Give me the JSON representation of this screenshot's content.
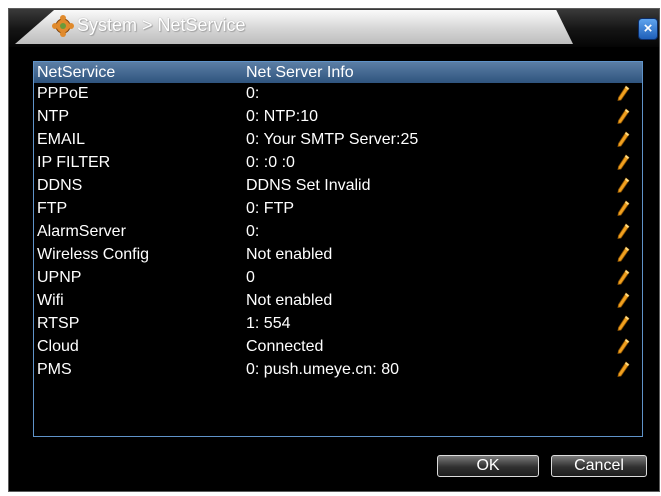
{
  "window": {
    "title": "System > NetService",
    "title_icon": "gear-icon",
    "close_label": "×"
  },
  "table": {
    "headers": [
      "NetService",
      "Net Server Info"
    ],
    "rows": [
      {
        "service": "PPPoE",
        "info": "0:"
      },
      {
        "service": "NTP",
        "info": "0: NTP:10"
      },
      {
        "service": "EMAIL",
        "info": "0: Your SMTP Server:25"
      },
      {
        "service": "IP FILTER",
        "info": "0: :0 :0"
      },
      {
        "service": "DDNS",
        "info": "DDNS Set Invalid"
      },
      {
        "service": "FTP",
        "info": "0: FTP"
      },
      {
        "service": "AlarmServer",
        "info": "0:"
      },
      {
        "service": "Wireless Config",
        "info": "Not enabled"
      },
      {
        "service": "UPNP",
        "info": "0"
      },
      {
        "service": "Wifi",
        "info": "Not enabled"
      },
      {
        "service": "RTSP",
        "info": "1: 554"
      },
      {
        "service": "Cloud",
        "info": "Connected"
      },
      {
        "service": "PMS",
        "info": "0: push.umeye.cn: 80"
      }
    ],
    "row_action_icon": "pencil-icon"
  },
  "buttons": {
    "ok_label": "OK",
    "cancel_label": "Cancel"
  },
  "colors": {
    "background": "#000000",
    "panel_border": "#5f93c9",
    "header_bg": "#46698f",
    "pencil": "#f0a020",
    "close_button": "#2f77d6"
  }
}
